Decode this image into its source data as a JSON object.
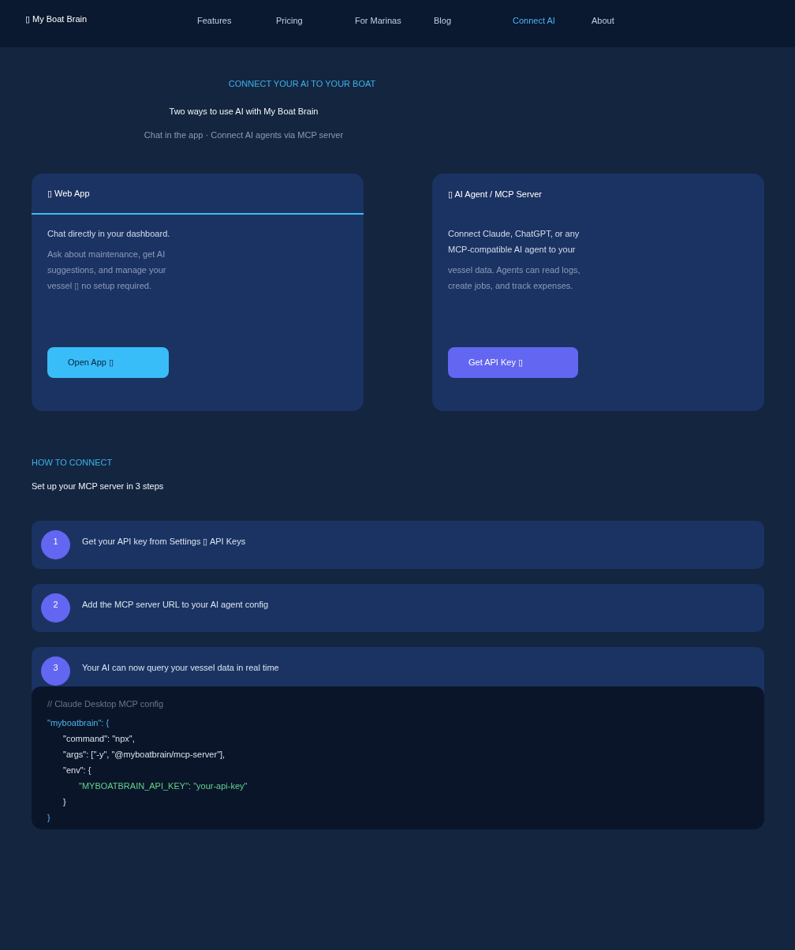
{
  "nav": {
    "brand": "▯ My Boat Brain",
    "links": [
      {
        "label": "Features",
        "selected": false
      },
      {
        "label": "Pricing",
        "selected": false
      },
      {
        "label": "For Marinas",
        "selected": false
      },
      {
        "label": "Blog",
        "selected": false
      },
      {
        "label": "Connect AI",
        "selected": true
      },
      {
        "label": "About",
        "selected": false
      }
    ]
  },
  "hero": {
    "eyebrow": "CONNECT YOUR AI TO YOUR BOAT",
    "title": "Two ways to use AI with My Boat Brain",
    "subtitle": "Chat in the app · Connect AI agents via MCP server"
  },
  "cards": [
    {
      "title": "▯ Web App",
      "active": true,
      "lead": "Chat directly in your dashboard.",
      "description": "Ask about maintenance, get AI suggestions, and manage your vessel ▯ no setup required.",
      "button": {
        "label": "Open App ▯",
        "color": "#38bdf8"
      }
    },
    {
      "title": "▯ AI Agent / MCP Server",
      "active": false,
      "lead": "Connect Claude, ChatGPT, or any MCP-compatible AI agent to your",
      "description": "vessel data. Agents can read logs, create jobs, and track expenses.",
      "button": {
        "label": "Get API Key ▯",
        "color": "#6366f1"
      }
    }
  ],
  "how_to": {
    "eyebrow": "HOW TO CONNECT",
    "title": "Set up your MCP server in 3 steps",
    "steps": [
      {
        "number": "1",
        "text": "Get your API key from Settings ▯ API Keys"
      },
      {
        "number": "2",
        "text": "Add the MCP server URL to your AI agent config"
      },
      {
        "number": "3",
        "text": "Your AI can now query your vessel data in real time",
        "code": {
          "comment": "// Claude Desktop MCP config",
          "lines": [
            {
              "text": "\"myboatbrain\": {",
              "kind": "key",
              "children": [
                {
                  "text": "\"command\": \"npx\",",
                  "kind": "plain"
                },
                {
                  "text": "\"args\": [\"-y\", \"@myboatbrain/mcp-server\"],",
                  "kind": "plain"
                },
                {
                  "text": "\"env\": {",
                  "kind": "plain",
                  "children": [
                    {
                      "text": "\"MYBOATBRAIN_API_KEY\": \"your-api-key\"",
                      "kind": "string"
                    }
                  ]
                },
                {
                  "text": "}",
                  "kind": "plain"
                }
              ]
            },
            {
              "text": "}",
              "kind": "key"
            }
          ]
        }
      }
    ]
  }
}
